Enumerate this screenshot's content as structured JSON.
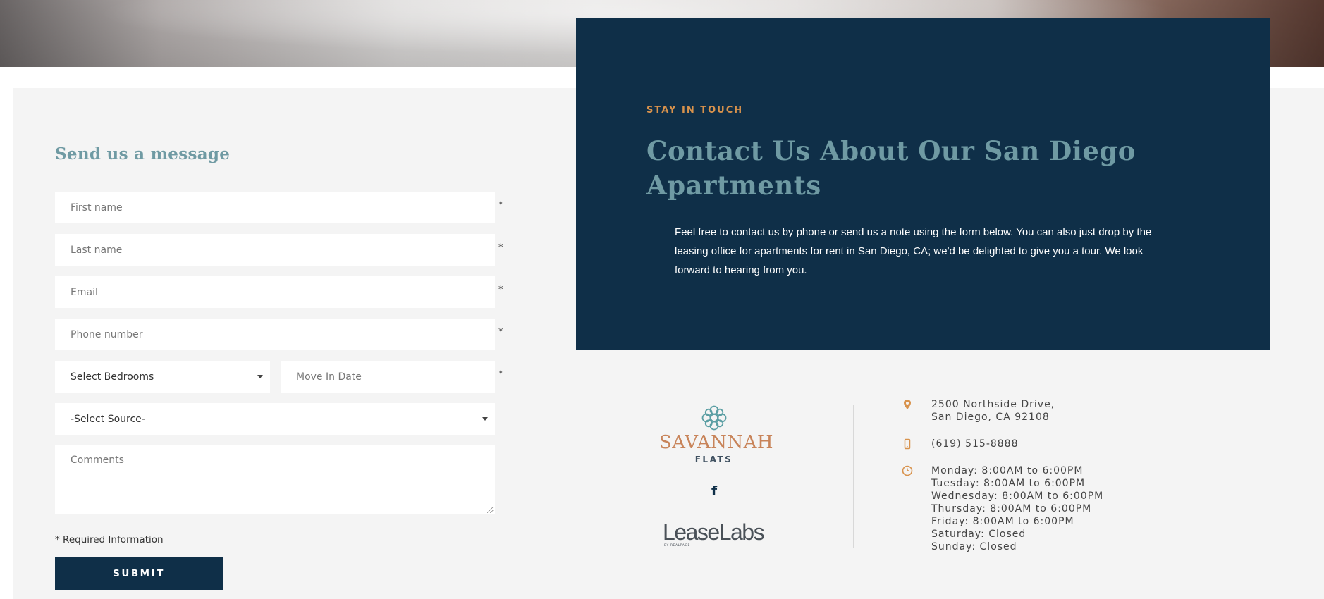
{
  "form": {
    "title": "Send us a message",
    "first_name_placeholder": "First name",
    "last_name_placeholder": "Last name",
    "email_placeholder": "Email",
    "phone_placeholder": "Phone number",
    "bedrooms_selected": "Select Bedrooms",
    "move_in_placeholder": "Move In Date",
    "source_selected": "-Select Source-",
    "comments_placeholder": "Comments",
    "required_marker": "*",
    "required_note": "* Required Information",
    "submit_label": "SUBMIT"
  },
  "contact": {
    "eyebrow": "STAY IN TOUCH",
    "title": "Contact Us About Our San Diego Apartments",
    "copy": "Feel free to contact us by phone or send us a note using the form below. You can also just drop by the leasing office for apartments for rent in San Diego, CA; we'd be delighted to give you a tour. We look forward to hearing from you."
  },
  "logo": {
    "name": "SAVANNAH",
    "sub": "FLATS"
  },
  "partner": {
    "name": "LeaseLabs",
    "sub": "BY REALPAGE"
  },
  "info": {
    "address_line1": "2500 Northside Drive,",
    "address_line2": "San Diego, CA 92108",
    "phone": "(619) 515-8888",
    "hours": [
      "Monday: 8:00AM to 6:00PM",
      "Tuesday: 8:00AM to 6:00PM",
      "Wednesday: 8:00AM to 6:00PM",
      "Thursday: 8:00AM to 6:00PM",
      "Friday: 8:00AM to 6:00PM",
      "Saturday: Closed",
      "Sunday: Closed"
    ]
  },
  "colors": {
    "navy": "#0f2f48",
    "teal_heading": "#6f9aa3",
    "accent_orange": "#d8924c",
    "panel_gray": "#f4f4f4"
  },
  "icons": {
    "location": "map-pin-icon",
    "phone": "mobile-phone-icon",
    "hours": "clock-icon",
    "social": "facebook-icon"
  }
}
